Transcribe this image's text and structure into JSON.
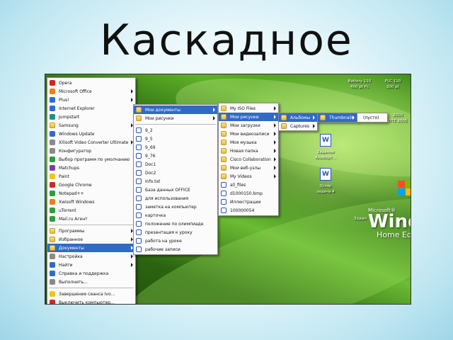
{
  "slide": {
    "title": "Каскадное"
  },
  "start_menu": {
    "items": [
      {
        "label": "Opera",
        "icon": "opera-icon",
        "arrow": false,
        "color": "red-ic"
      },
      {
        "label": "Microsoft Office",
        "icon": "office-icon",
        "arrow": true,
        "color": "orange-ic"
      },
      {
        "label": "Plus!",
        "icon": "plus-icon",
        "arrow": true,
        "color": "blue-ic"
      },
      {
        "label": "Internet Explorer",
        "icon": "ie-icon",
        "arrow": false,
        "color": "blue-ic"
      },
      {
        "label": "Jumpstart",
        "icon": "jumpstart-icon",
        "arrow": false,
        "color": "teal-ic"
      },
      {
        "label": "Samsung",
        "icon": "samsung-icon",
        "arrow": true,
        "color": "folder-ic"
      },
      {
        "label": "Windows Update",
        "icon": "windows-update-icon",
        "arrow": false,
        "color": "blue-ic"
      },
      {
        "label": "Xilisoft Video Converter Ultimate",
        "icon": "video-converter-icon",
        "arrow": true,
        "color": "gray-ic"
      },
      {
        "label": "Конфигуратор",
        "icon": "configurator-icon",
        "arrow": false,
        "color": "gray-ic"
      },
      {
        "label": "Выбор программ по умолчанию",
        "icon": "default-programs-icon",
        "arrow": false,
        "color": "green-ic"
      },
      {
        "label": "Matchups",
        "icon": "matchups-icon",
        "arrow": false,
        "color": "purple-ic"
      },
      {
        "label": "Paint",
        "icon": "paint-icon",
        "arrow": false,
        "color": "yellow-ic"
      },
      {
        "label": "Google Chrome",
        "icon": "chrome-icon",
        "arrow": false,
        "color": "red-ic"
      },
      {
        "label": "Notepad++",
        "icon": "notepad-icon",
        "arrow": false,
        "color": "green-ic"
      },
      {
        "label": "Xwisoft Windows",
        "icon": "xwisoft-icon",
        "arrow": false,
        "color": "orange-ic"
      },
      {
        "label": "uTorrent",
        "icon": "utorrent-icon",
        "arrow": false,
        "color": "green-ic"
      },
      {
        "label": "Mail.ru Агент",
        "icon": "mail-agent-icon",
        "arrow": false,
        "color": "green-ic"
      },
      {
        "label": "Программы",
        "icon": "programs-icon",
        "arrow": true,
        "color": "folder-ic"
      },
      {
        "label": "Избранное",
        "icon": "favorites-icon",
        "arrow": true,
        "color": "folder-ic"
      },
      {
        "label": "Документы",
        "icon": "documents-icon",
        "arrow": true,
        "color": "folder-ic",
        "highlight": true
      },
      {
        "label": "Настройка",
        "icon": "settings-icon",
        "arrow": true,
        "color": "gray-ic"
      },
      {
        "label": "Найти",
        "icon": "search-icon",
        "arrow": true,
        "color": "blue-ic"
      },
      {
        "label": "Справка и поддержка",
        "icon": "help-icon",
        "arrow": false,
        "color": "blue-ic"
      },
      {
        "label": "Выполнить...",
        "icon": "run-icon",
        "arrow": false,
        "color": "gray-ic"
      },
      {
        "label": "Завершение сеанса Ivo...",
        "icon": "logoff-icon",
        "arrow": false,
        "color": "yellow-ic"
      },
      {
        "label": "Выключить компьютер...",
        "icon": "shutdown-icon",
        "arrow": false,
        "color": "red-ic"
      }
    ]
  },
  "documents_menu": {
    "items": [
      {
        "label": "Мои документы",
        "arrow": true,
        "color": "folder-ic",
        "highlight": true
      },
      {
        "label": "Мои рисунки",
        "arrow": true,
        "color": "folder-ic"
      },
      {
        "label": "9_2",
        "arrow": false,
        "color": "doc-ic"
      },
      {
        "label": "9_5",
        "arrow": false,
        "color": "doc-ic"
      },
      {
        "label": "9_69",
        "arrow": false,
        "color": "doc-ic"
      },
      {
        "label": "9_76",
        "arrow": false,
        "color": "doc-ic"
      },
      {
        "label": "Doc1",
        "arrow": false,
        "color": "doc-ic"
      },
      {
        "label": "Doc2",
        "arrow": false,
        "color": "doc-ic"
      },
      {
        "label": "Info.txt",
        "arrow": false,
        "color": "doc-ic"
      },
      {
        "label": "База данных OFFICE",
        "arrow": false,
        "color": "doc-ic"
      },
      {
        "label": "для использования",
        "arrow": false,
        "color": "doc-ic"
      },
      {
        "label": "заметка на компьютер",
        "arrow": false,
        "color": "doc-ic"
      },
      {
        "label": "карточка",
        "arrow": false,
        "color": "doc-ic"
      },
      {
        "label": "положение по олимпиаде",
        "arrow": false,
        "color": "doc-ic"
      },
      {
        "label": "презентация к уроку",
        "arrow": false,
        "color": "doc-ic"
      },
      {
        "label": "работа на уроке",
        "arrow": false,
        "color": "doc-ic"
      },
      {
        "label": "рабочие записи",
        "arrow": false,
        "color": "doc-ic"
      }
    ]
  },
  "my_documents_menu": {
    "items": [
      {
        "label": "My ISO Files",
        "arrow": true,
        "color": "folder-ic"
      },
      {
        "label": "Мои рисунки",
        "arrow": true,
        "color": "folder-ic",
        "highlight": true
      },
      {
        "label": "Мои загрузки",
        "arrow": true,
        "color": "folder-ic"
      },
      {
        "label": "Мои видеозаписи",
        "arrow": true,
        "color": "folder-ic"
      },
      {
        "label": "Моя музыка",
        "arrow": true,
        "color": "folder-ic"
      },
      {
        "label": "Новая папка",
        "arrow": true,
        "color": "folder-ic"
      },
      {
        "label": "Cisco Collaboration",
        "arrow": true,
        "color": "folder-ic"
      },
      {
        "label": "Мои веб-узлы",
        "arrow": true,
        "color": "folder-ic"
      },
      {
        "label": "My Videos",
        "arrow": true,
        "color": "folder-ic"
      },
      {
        "label": "all_files",
        "arrow": false,
        "color": "doc-ic"
      },
      {
        "label": "d1000150.bmp",
        "arrow": false,
        "color": "doc-ic"
      },
      {
        "label": "Иллюстрации",
        "arrow": false,
        "color": "doc-ic"
      },
      {
        "label": "100000054",
        "arrow": false,
        "color": "doc-ic"
      }
    ]
  },
  "my_pictures_menu": {
    "items": [
      {
        "label": "Альбомы",
        "arrow": true,
        "color": "folder-ic",
        "highlight": true
      },
      {
        "label": "Captures",
        "arrow": true,
        "color": "folder-ic"
      }
    ]
  },
  "albums_menu": {
    "items": [
      {
        "label": "Thumbnails",
        "arrow": true,
        "color": "folder-ic",
        "highlight": true
      }
    ]
  },
  "thumbnails_menu": {
    "items": [
      {
        "label": "(пусто)",
        "arrow": false
      }
    ]
  },
  "desktop": {
    "brand_ms": "Microsoft®",
    "brand_big": "Windo",
    "brand_edition": "Home Ed",
    "texts": [
      {
        "label": "Battery 110"
      },
      {
        "label": "400 pt Pc"
      },
      {
        "label": "PLC 110"
      },
      {
        "label": "300 pt"
      },
      {
        "label": "2010"
      },
      {
        "label": "ОТЕ 2005"
      },
      {
        "label": "Задание"
      },
      {
        "label": "Альберт..."
      },
      {
        "label": "Зуляр"
      },
      {
        "label": "задача 4"
      },
      {
        "label": "Задан"
      }
    ]
  }
}
